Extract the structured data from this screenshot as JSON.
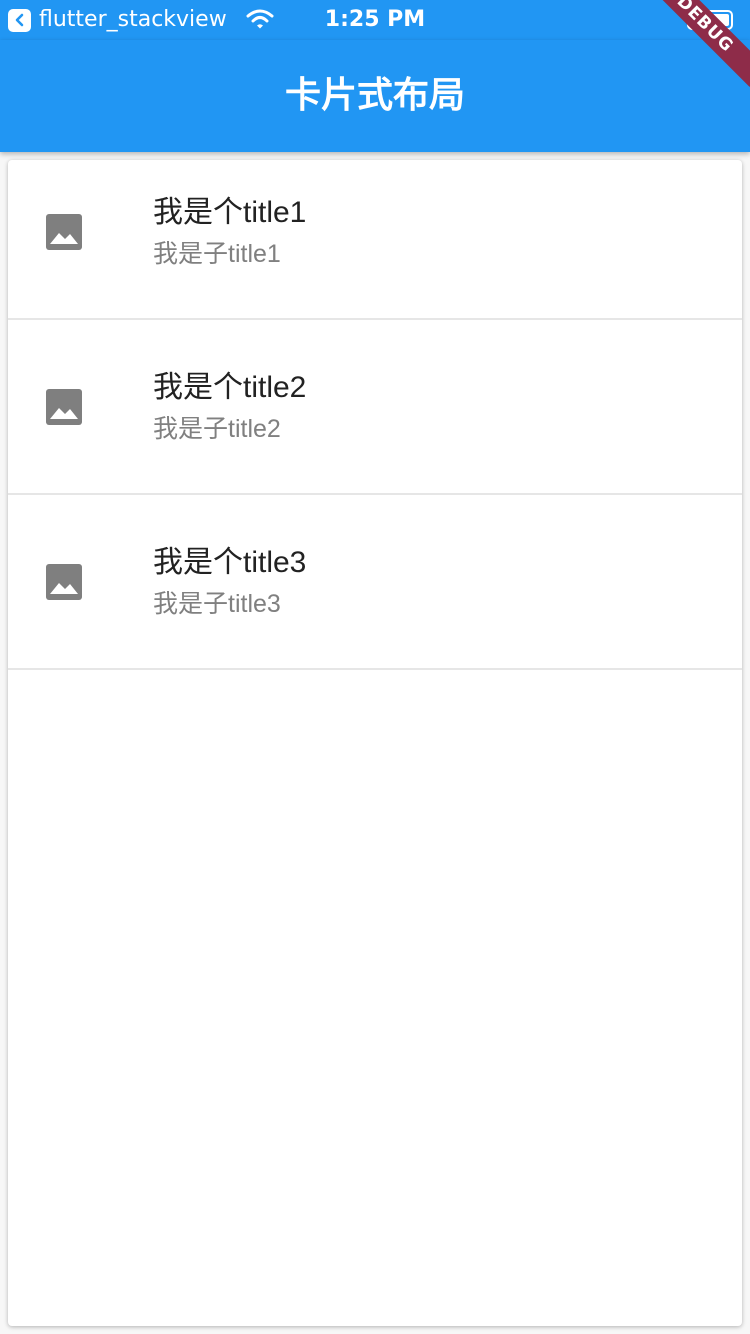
{
  "status_bar": {
    "back_app_name": "flutter_stackview",
    "time": "1:25 PM",
    "battery_level": 1.0
  },
  "debug_banner": "DEBUG",
  "app_bar": {
    "title": "卡片式布局",
    "color": "#2196f3"
  },
  "card": {
    "items": [
      {
        "icon": "image-icon",
        "title": "我是个title1",
        "subtitle": "我是子title1"
      },
      {
        "icon": "image-icon",
        "title": "我是个title2",
        "subtitle": "我是子title2"
      },
      {
        "icon": "image-icon",
        "title": "我是个title3",
        "subtitle": "我是子title3"
      }
    ]
  }
}
